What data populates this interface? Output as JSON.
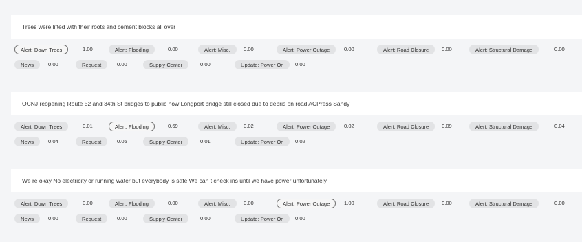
{
  "items": [
    {
      "sentence": "Trees were lifted with their roots and cement blocks all over",
      "labels": [
        {
          "label": "Alert: Down Trees",
          "score": "1.00",
          "selected": true
        },
        {
          "label": "Alert: Flooding",
          "score": "0.00",
          "selected": false
        },
        {
          "label": "Alert: Misc.",
          "score": "0.00",
          "selected": false
        },
        {
          "label": "Alert: Power Outage",
          "score": "0.00",
          "selected": false
        },
        {
          "label": "Alert: Road Closure",
          "score": "0.00",
          "selected": false
        },
        {
          "label": "Alert: Structural Damage",
          "score": "0.00",
          "selected": false
        },
        {
          "label": "News",
          "score": "0.00",
          "selected": false
        },
        {
          "label": "Request",
          "score": "0.00",
          "selected": false
        },
        {
          "label": "Supply Center",
          "score": "0.00",
          "selected": false
        },
        {
          "label": "Update: Power On",
          "score": "0.00",
          "selected": false
        }
      ]
    },
    {
      "sentence": "OCNJ reopening Route 52 and 34th St bridges to public now Longport bridge still closed due to debris on road ACPress Sandy",
      "labels": [
        {
          "label": "Alert: Down Trees",
          "score": "0.01",
          "selected": false
        },
        {
          "label": "Alert: Flooding",
          "score": "0.69",
          "selected": true
        },
        {
          "label": "Alert: Misc.",
          "score": "0.02",
          "selected": false
        },
        {
          "label": "Alert: Power Outage",
          "score": "0.02",
          "selected": false
        },
        {
          "label": "Alert: Road Closure",
          "score": "0.09",
          "selected": false
        },
        {
          "label": "Alert: Structural Damage",
          "score": "0.04",
          "selected": false
        },
        {
          "label": "News",
          "score": "0.04",
          "selected": false
        },
        {
          "label": "Request",
          "score": "0.05",
          "selected": false
        },
        {
          "label": "Supply Center",
          "score": "0.01",
          "selected": false
        },
        {
          "label": "Update: Power On",
          "score": "0.02",
          "selected": false
        }
      ]
    },
    {
      "sentence": "We re okay No electricity or running water but everybody is safe We can t check ins until we have power unfortunately",
      "labels": [
        {
          "label": "Alert: Down Trees",
          "score": "0.00",
          "selected": false
        },
        {
          "label": "Alert: Flooding",
          "score": "0.00",
          "selected": false
        },
        {
          "label": "Alert: Misc.",
          "score": "0.00",
          "selected": false
        },
        {
          "label": "Alert: Power Outage",
          "score": "1.00",
          "selected": true
        },
        {
          "label": "Alert: Road Closure",
          "score": "0.00",
          "selected": false
        },
        {
          "label": "Alert: Structural Damage",
          "score": "0.00",
          "selected": false
        },
        {
          "label": "News",
          "score": "0.00",
          "selected": false
        },
        {
          "label": "Request",
          "score": "0.00",
          "selected": false
        },
        {
          "label": "Supply Center",
          "score": "0.00",
          "selected": false
        },
        {
          "label": "Update: Power On",
          "score": "0.00",
          "selected": false
        }
      ]
    }
  ]
}
